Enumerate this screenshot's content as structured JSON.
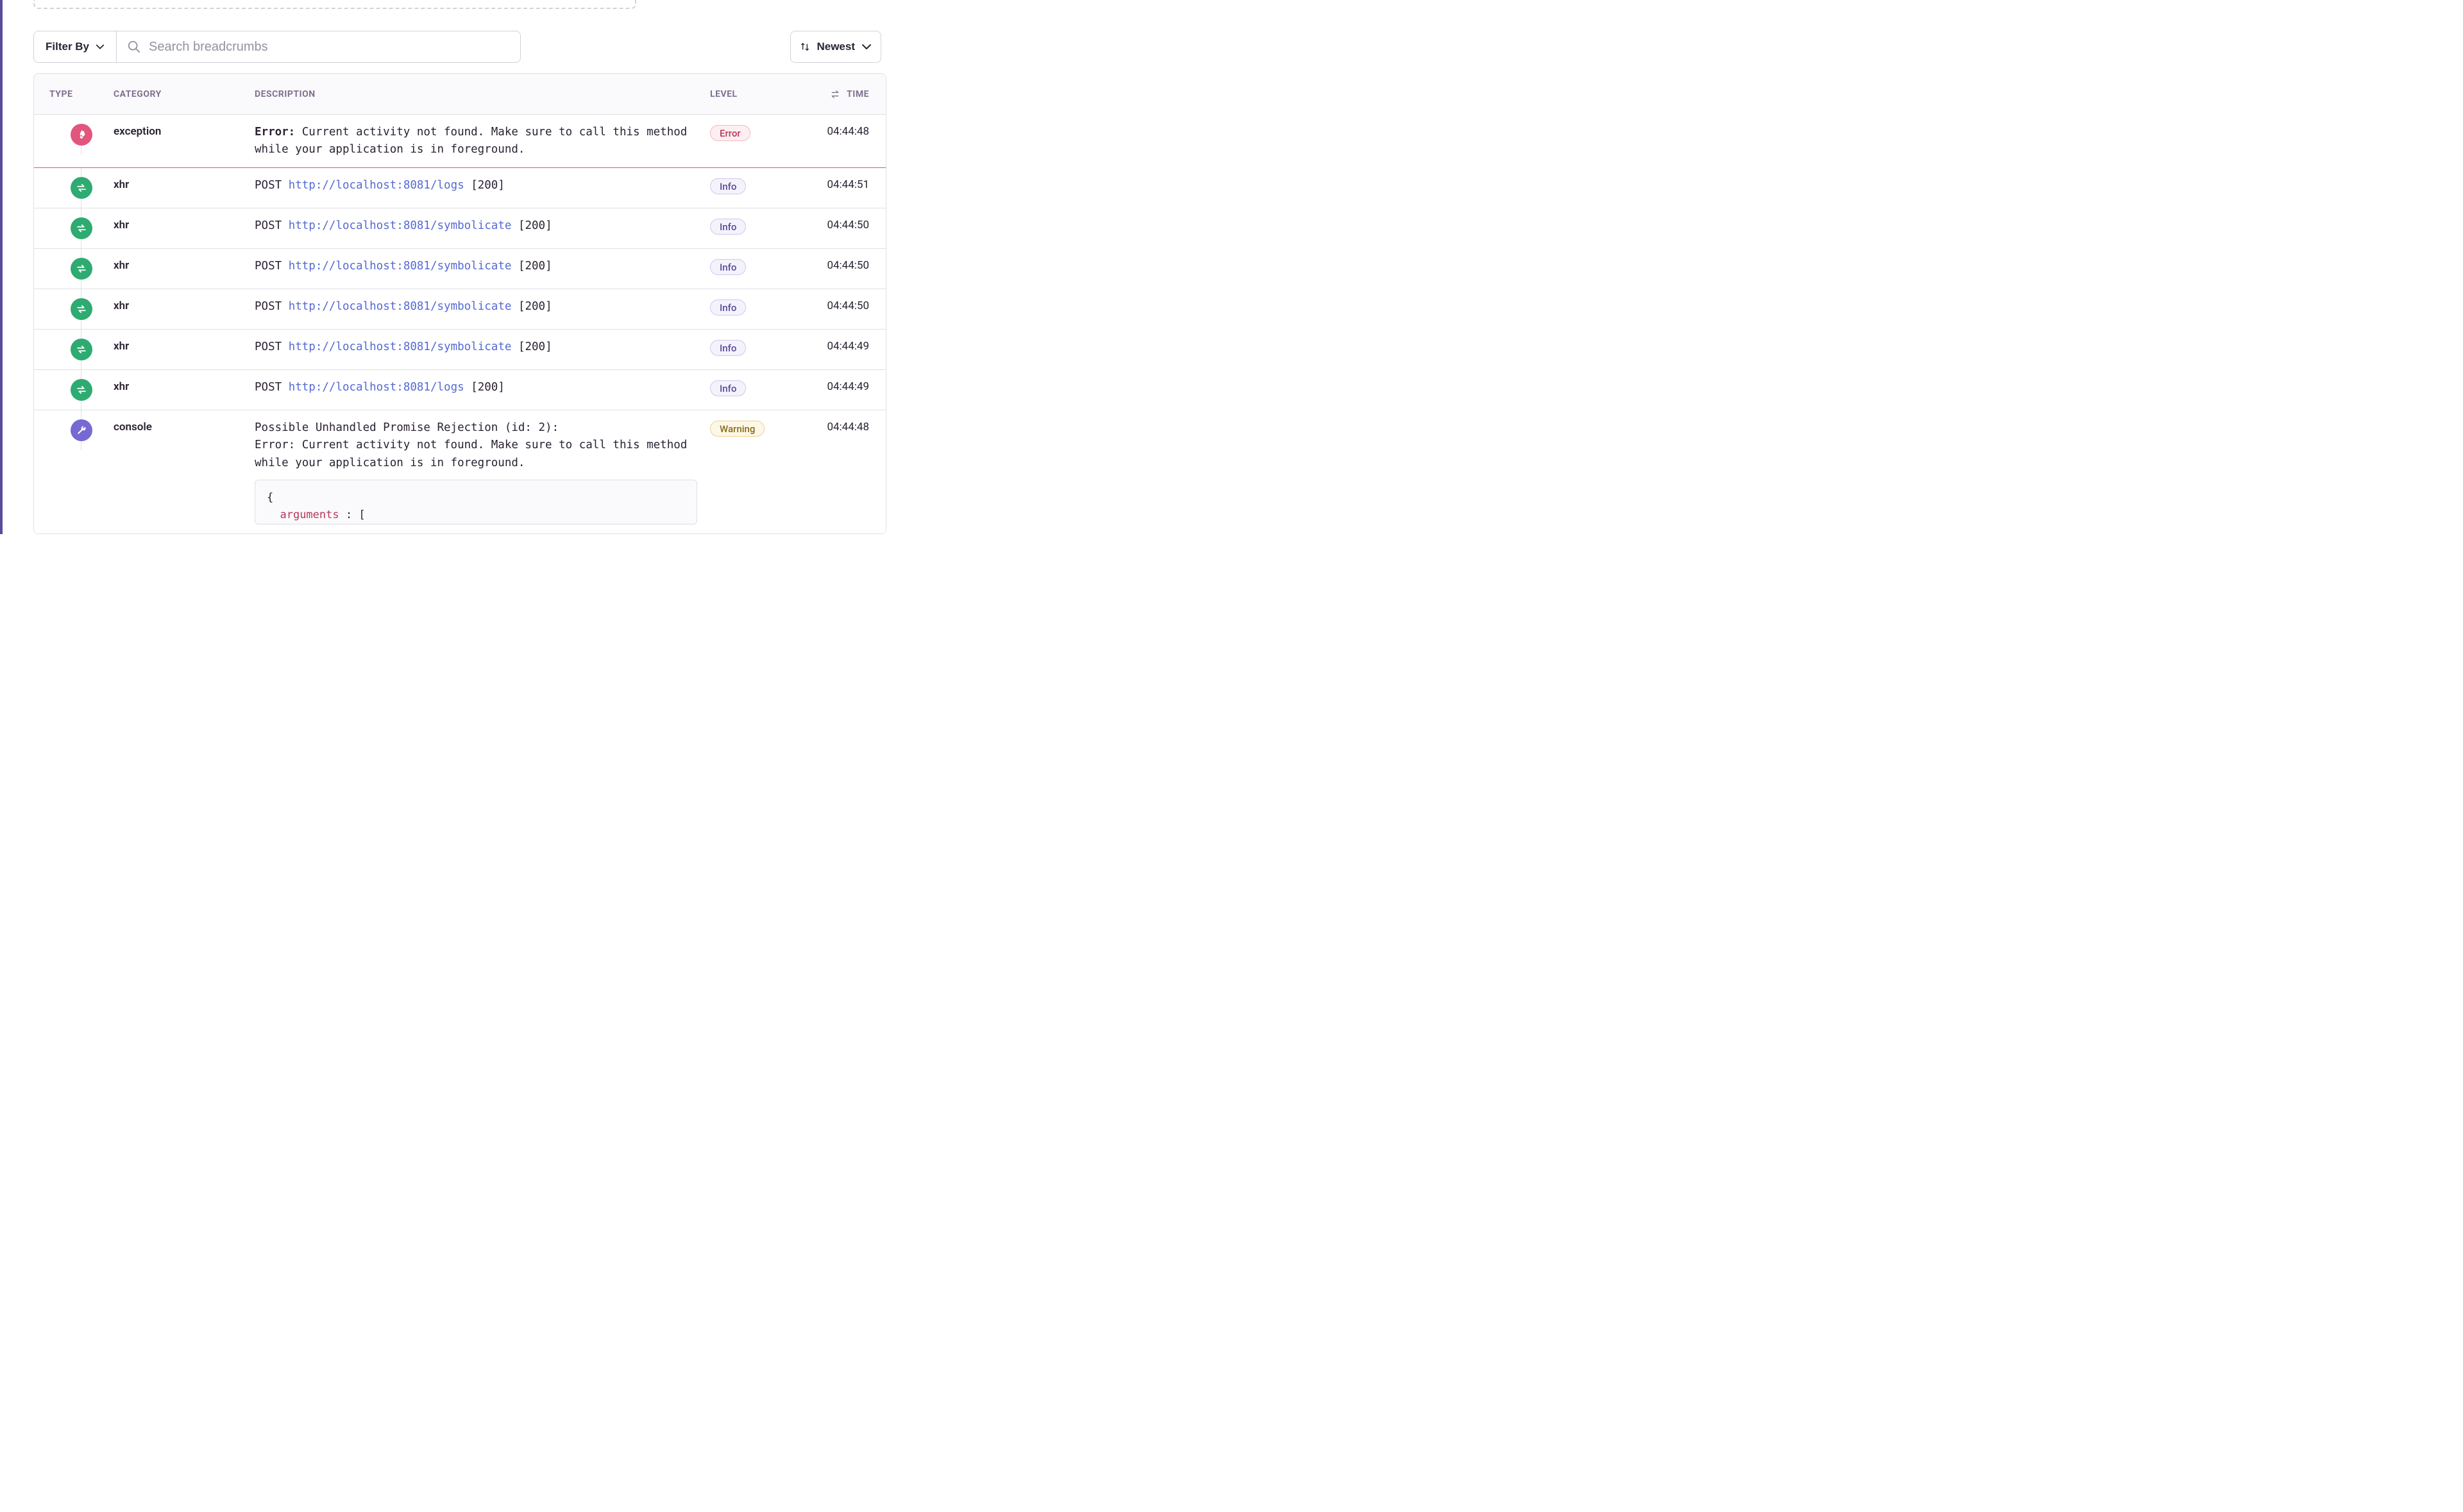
{
  "toolbar": {
    "filter_label": "Filter By",
    "search_placeholder": "Search breadcrumbs",
    "sort_label": "Newest"
  },
  "columns": {
    "type": "TYPE",
    "category": "CATEGORY",
    "description": "DESCRIPTION",
    "level": "LEVEL",
    "time": "TIME"
  },
  "rows": [
    {
      "icon": "error",
      "category": "exception",
      "desc_prefix": "Error:",
      "desc_text": " Current activity not found. Make sure to call this method while your application is in foreground.",
      "level": "Error",
      "level_kind": "error",
      "time": "04:44:48"
    },
    {
      "icon": "xhr",
      "category": "xhr",
      "method": "POST",
      "url": "http://localhost:8081/logs",
      "status": "[200]",
      "level": "Info",
      "level_kind": "info",
      "time": "04:44:51"
    },
    {
      "icon": "xhr",
      "category": "xhr",
      "method": "POST",
      "url": "http://localhost:8081/symbolicate",
      "status": "[200]",
      "level": "Info",
      "level_kind": "info",
      "time": "04:44:50"
    },
    {
      "icon": "xhr",
      "category": "xhr",
      "method": "POST",
      "url": "http://localhost:8081/symbolicate",
      "status": "[200]",
      "level": "Info",
      "level_kind": "info",
      "time": "04:44:50"
    },
    {
      "icon": "xhr",
      "category": "xhr",
      "method": "POST",
      "url": "http://localhost:8081/symbolicate",
      "status": "[200]",
      "level": "Info",
      "level_kind": "info",
      "time": "04:44:50"
    },
    {
      "icon": "xhr",
      "category": "xhr",
      "method": "POST",
      "url": "http://localhost:8081/symbolicate",
      "status": "[200]",
      "level": "Info",
      "level_kind": "info",
      "time": "04:44:49"
    },
    {
      "icon": "xhr",
      "category": "xhr",
      "method": "POST",
      "url": "http://localhost:8081/logs",
      "status": "[200]",
      "level": "Info",
      "level_kind": "info",
      "time": "04:44:49"
    },
    {
      "icon": "console",
      "category": "console",
      "desc_text": "Possible Unhandled Promise Rejection (id: 2):\nError: Current activity not found. Make sure to call this method while your application is in foreground.",
      "code_open": "{",
      "code_key": "arguments",
      "code_after": " : [",
      "level": "Warning",
      "level_kind": "warning",
      "time": "04:44:48"
    }
  ]
}
